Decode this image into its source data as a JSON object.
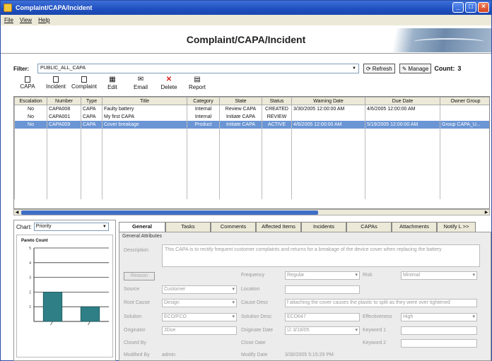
{
  "window": {
    "title": "Complaint/CAPA/Incident"
  },
  "menu": [
    "File",
    "View",
    "Help"
  ],
  "banner": {
    "title": "Complaint/CAPA/Incident"
  },
  "filter": {
    "label": "Filter:",
    "value": "PUBLIC_ALL_CAPA",
    "refresh": "Refresh",
    "manage": "Manage",
    "count_label": "Count:",
    "count": "3"
  },
  "toolbar": [
    {
      "label1": "CAPA",
      "label2": "",
      "icon": "new-doc-icon"
    },
    {
      "label1": "Incident",
      "label2": "",
      "icon": "new-doc-icon"
    },
    {
      "label1": "Complaint",
      "label2": "",
      "icon": "new-doc-icon"
    },
    {
      "label1": "Edit",
      "label2": "",
      "icon": "edit-icon"
    },
    {
      "label1": "Email",
      "label2": "",
      "icon": "email-icon"
    },
    {
      "label1": "Delete",
      "label2": "",
      "icon": "delete-icon"
    },
    {
      "label1": "Report",
      "label2": "",
      "icon": "report-icon"
    }
  ],
  "grid": {
    "columns": [
      "Escalation",
      "Number",
      "Type",
      "Title",
      "Category",
      "State",
      "Status",
      "Warning Date",
      "Due Date",
      "Owner Group"
    ],
    "rows": [
      [
        "No",
        "CAPA008",
        "CAPA",
        "Faulty battery",
        "Internal",
        "Review CAPA",
        "CREATED",
        "3/30/2005 12:00:00 AM",
        "4/6/2005 12:00:00 AM",
        ""
      ],
      [
        "No",
        "CAPA001",
        "CAPA",
        "My first CAPA",
        "Internal",
        "Initiate CAPA",
        "REVIEW",
        "",
        "",
        ""
      ],
      [
        "No",
        "CAPA009",
        "CAPA",
        "Cover breakage",
        "Product",
        "Initiate CAPA",
        "ACTIVE",
        "4/6/2005 12:00:00 AM",
        "5/19/2005 12:00:00 AM",
        "Group CAPA_U..."
      ]
    ],
    "selected_row": 2
  },
  "chart_panel": {
    "label": "Chart:",
    "selected": "Priority",
    "title": "Pareto Count"
  },
  "chart_data": {
    "type": "bar",
    "title": "Pareto Count",
    "categories": [
      "",
      ""
    ],
    "values": [
      2,
      1
    ],
    "yticks": [
      "1",
      "2",
      "3",
      "4",
      "5"
    ],
    "ylim": [
      0,
      5
    ]
  },
  "tabs": [
    "General",
    "Tasks",
    "Comments",
    "Affected Items",
    "Incidents",
    "CAPAs",
    "Attachments",
    "Notify L >>"
  ],
  "detail": {
    "section": "General Attributes",
    "description_label": "Description",
    "description": "This CAPA is to rectify frequent customer complaints and returns for a breakage of the device cover when replacing the battery",
    "reason_btn": "Reason",
    "frequency_label": "Frequency",
    "frequency": "Regular",
    "risk_label": "Risk",
    "risk": "Minimal",
    "source_label": "Source",
    "source": "Customer",
    "location_label": "Location",
    "location": "",
    "rootcause_label": "Root Cause",
    "rootcause": "Design",
    "causedesc_label": "Cause Desc",
    "causedesc": "f attaching the cover causes the plastic to split as they were over tightened",
    "solution_label": "Solution",
    "solution": "ECO/FCO",
    "solutiondesc_label": "Solution Desc",
    "solutiondesc": "ECO647",
    "effectiveness_label": "Effectiveness",
    "effectiveness": "High",
    "originator_label": "Originator",
    "originator": "JDoe",
    "originatedate_label": "Originate Date",
    "originatedate": "3/18/05",
    "keyword1_label": "Keyword 1",
    "keyword1": "",
    "closedby_label": "Closed By",
    "closedby": "",
    "closedate_label": "Close Date",
    "closedate": "",
    "keyword2_label": "Keyword 2",
    "keyword2": "",
    "modifiedby_label": "Modified By",
    "modifiedby": "admin",
    "modifydate_label": "Modify Date",
    "modifydate": "3/30/2005 5:15:29 PM"
  }
}
